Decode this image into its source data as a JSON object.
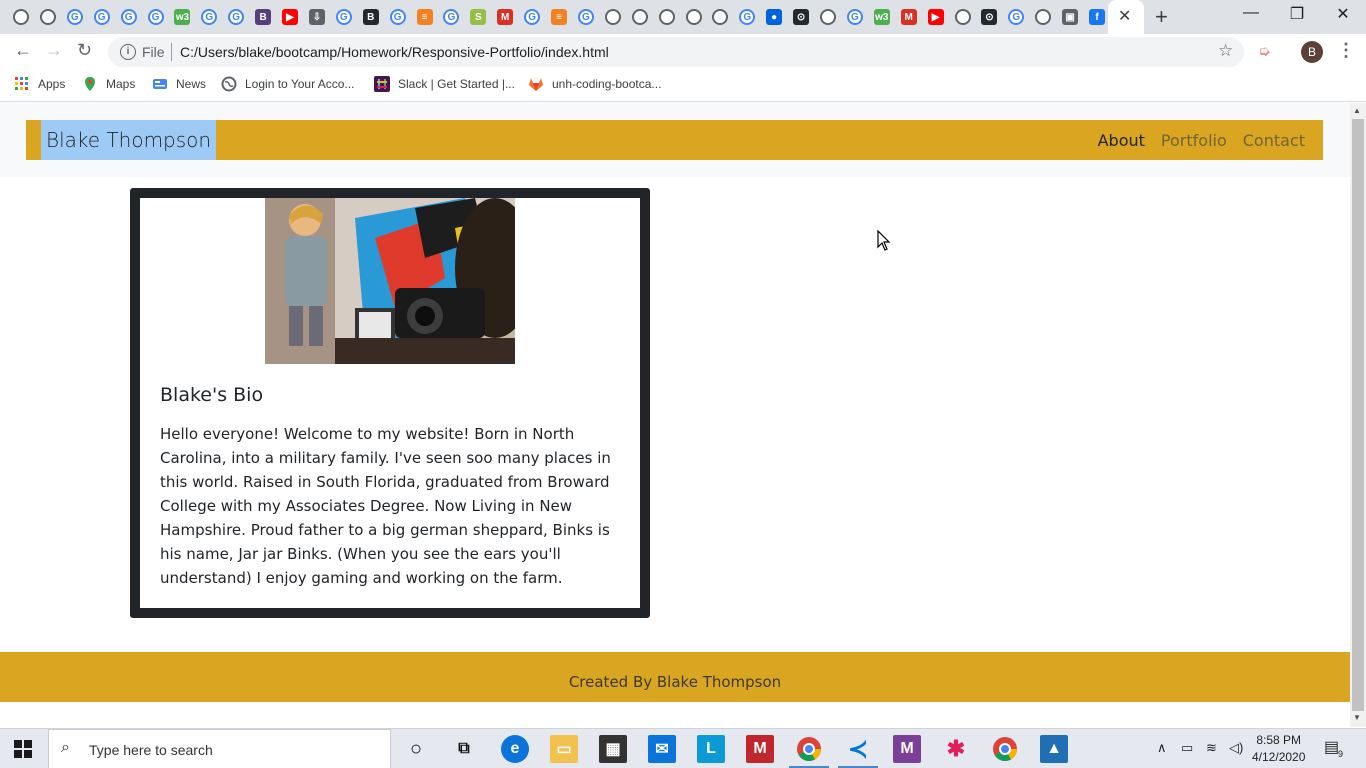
{
  "browser": {
    "tabs": [
      {
        "icon": "globe-icon"
      },
      {
        "icon": "globe-icon"
      },
      {
        "icon": "google-icon",
        "letter": "G"
      },
      {
        "icon": "google-icon",
        "letter": "G"
      },
      {
        "icon": "google-icon",
        "letter": "G"
      },
      {
        "icon": "google-icon",
        "letter": "G"
      },
      {
        "icon": "w3schools-icon",
        "letter": "w3"
      },
      {
        "icon": "google-icon",
        "letter": "G"
      },
      {
        "icon": "google-icon",
        "letter": "G"
      },
      {
        "icon": "bootstrap-icon",
        "letter": "B"
      },
      {
        "icon": "youtube-icon",
        "letter": "▶"
      },
      {
        "icon": "download-icon",
        "letter": "⇩"
      },
      {
        "icon": "google-icon",
        "letter": "G"
      },
      {
        "icon": "bold-b-icon",
        "letter": "B"
      },
      {
        "icon": "google-icon",
        "letter": "G"
      },
      {
        "icon": "stackoverflow-icon",
        "letter": "≡"
      },
      {
        "icon": "google-icon",
        "letter": "G"
      },
      {
        "icon": "shopify-icon",
        "letter": "S"
      },
      {
        "icon": "gmail-icon",
        "letter": "M"
      },
      {
        "icon": "google-icon",
        "letter": "G"
      },
      {
        "icon": "stackoverflow-icon",
        "letter": "≡"
      },
      {
        "icon": "google-icon",
        "letter": "G"
      },
      {
        "icon": "globe-icon"
      },
      {
        "icon": "globe-icon"
      },
      {
        "icon": "globe-icon"
      },
      {
        "icon": "globe-icon"
      },
      {
        "icon": "globe-icon"
      },
      {
        "icon": "google-icon",
        "letter": "G"
      },
      {
        "icon": "flickr-icon",
        "letter": "●"
      },
      {
        "icon": "github-icon",
        "letter": "⊙"
      },
      {
        "icon": "globe-icon"
      },
      {
        "icon": "google-icon",
        "letter": "G"
      },
      {
        "icon": "w3schools-icon",
        "letter": "w3"
      },
      {
        "icon": "gmail-icon",
        "letter": "M"
      },
      {
        "icon": "youtube-icon",
        "letter": "▶"
      },
      {
        "icon": "globe-icon"
      },
      {
        "icon": "github-icon",
        "letter": "⊙"
      },
      {
        "icon": "google-icon",
        "letter": "G"
      },
      {
        "icon": "globe-icon"
      },
      {
        "icon": "image-icon",
        "letter": "▣"
      },
      {
        "icon": "facebook-icon",
        "letter": "f"
      }
    ],
    "colors": {
      "google": "#4285f4",
      "w3schools": "#4caf50",
      "bootstrap": "#563d7c",
      "youtube": "#ff0000",
      "stackoverflow": "#f48024",
      "shopify": "#96bf48",
      "gmail": "#d93025",
      "github": "#24292e",
      "facebook": "#1877f2",
      "flickr": "#0063dc"
    },
    "file_label": "File",
    "url": "C:/Users/blake/bootcamp/Homework/Responsive-Portfolio/index.html",
    "profile_initial": "B",
    "bookmarks": [
      {
        "label": "Apps",
        "icon": "apps-grid-icon"
      },
      {
        "label": "Maps",
        "icon": "maps-pin-icon"
      },
      {
        "label": "News",
        "icon": "news-icon"
      },
      {
        "label": "Login to Your Acco...",
        "icon": "globe-icon"
      },
      {
        "label": "Slack | Get Started |...",
        "icon": "slack-icon"
      },
      {
        "label": "unh-coding-bootca...",
        "icon": "gitlab-icon"
      }
    ]
  },
  "page": {
    "brand": "Blake Thompson",
    "nav": {
      "about": "About",
      "portfolio": "Portfolio",
      "contact": "Contact"
    },
    "bio_title": "Blake's Bio",
    "bio_text": "Hello everyone! Welcome to my website! Born in North Carolina, into a military family. I've seen soo many places in this world. Raised in South Florida, graduated from Broward College with my Associates Degree. Now Living in New Hampshire. Proud father to a big german sheppard, Binks is his name, Jar jar Binks. (When you see the ears you'll understand) I enjoy gaming and working on the farm.",
    "footer": "Created By Blake Thompson",
    "accent_color": "#daa520",
    "brand_highlight": "#9ecbf5"
  },
  "taskbar": {
    "search_placeholder": "Type here to search",
    "time": "8:58 PM",
    "date": "4/12/2020",
    "notification_count": "9"
  }
}
